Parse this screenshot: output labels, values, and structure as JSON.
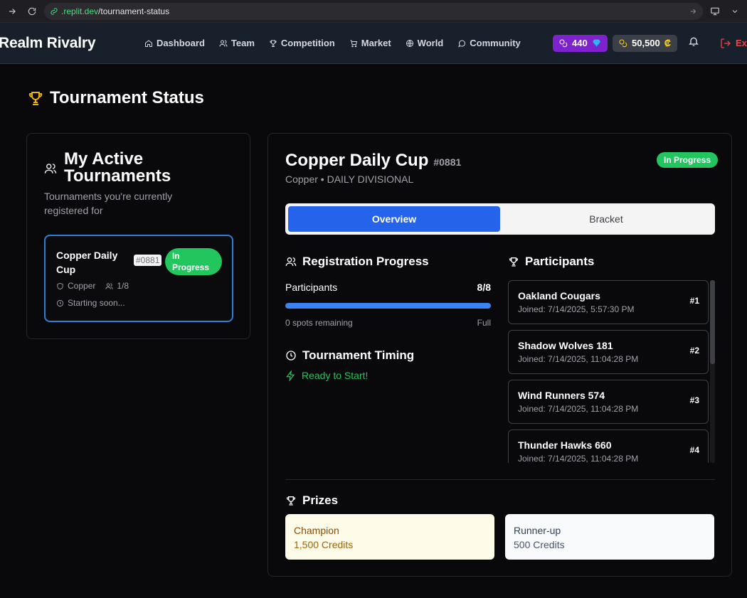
{
  "browser": {
    "url_host": ".replit.dev",
    "url_path": "/tournament-status"
  },
  "header": {
    "brand": "Realm Rivalry",
    "nav": [
      {
        "label": "Dashboard",
        "icon": "home-icon"
      },
      {
        "label": "Team",
        "icon": "users-icon"
      },
      {
        "label": "Competition",
        "icon": "trophy-icon"
      },
      {
        "label": "Market",
        "icon": "cart-icon"
      },
      {
        "label": "World",
        "icon": "globe-icon"
      },
      {
        "label": "Community",
        "icon": "chat-icon"
      }
    ],
    "gems": "440",
    "credits": "50,500",
    "logout_label": "Ex"
  },
  "page": {
    "title": "Tournament Status"
  },
  "my_tournaments": {
    "title": "My Active Tournaments",
    "description": "Tournaments you're currently registered for",
    "items": [
      {
        "name": "Copper Daily Cup",
        "id": "#0881",
        "status": "In Progress",
        "division": "Copper",
        "participants": "1/8",
        "timing": "Starting soon..."
      }
    ]
  },
  "tournament": {
    "name": "Copper Daily Cup",
    "id": "#0881",
    "subtitle": "Copper • DAILY DIVISIONAL",
    "status": "In Progress",
    "tabs": [
      "Overview",
      "Bracket"
    ],
    "active_tab": "Overview",
    "registration": {
      "title": "Registration Progress",
      "label": "Participants",
      "value": "8/8",
      "progress": 1.0,
      "remaining": "0 spots remaining",
      "state": "Full"
    },
    "timing": {
      "title": "Tournament Timing",
      "status": "Ready to Start!"
    },
    "participants_title": "Participants",
    "participants": [
      {
        "name": "Oakland Cougars",
        "joined": "Joined: 7/14/2025, 5:57:30 PM",
        "rank": "#1"
      },
      {
        "name": "Shadow Wolves 181",
        "joined": "Joined: 7/14/2025, 11:04:28 PM",
        "rank": "#2"
      },
      {
        "name": "Wind Runners 574",
        "joined": "Joined: 7/14/2025, 11:04:28 PM",
        "rank": "#3"
      },
      {
        "name": "Thunder Hawks 660",
        "joined": "Joined: 7/14/2025, 11:04:28 PM",
        "rank": "#4"
      }
    ],
    "prizes_title": "Prizes",
    "prizes": [
      {
        "label": "Champion",
        "value": "1,500 Credits"
      },
      {
        "label": "Runner-up",
        "value": "500 Credits"
      }
    ]
  },
  "colors": {
    "accent": "#2563eb",
    "success": "#22c55e",
    "gems_bg": "#7e22ce",
    "trophy": "#eab308"
  }
}
